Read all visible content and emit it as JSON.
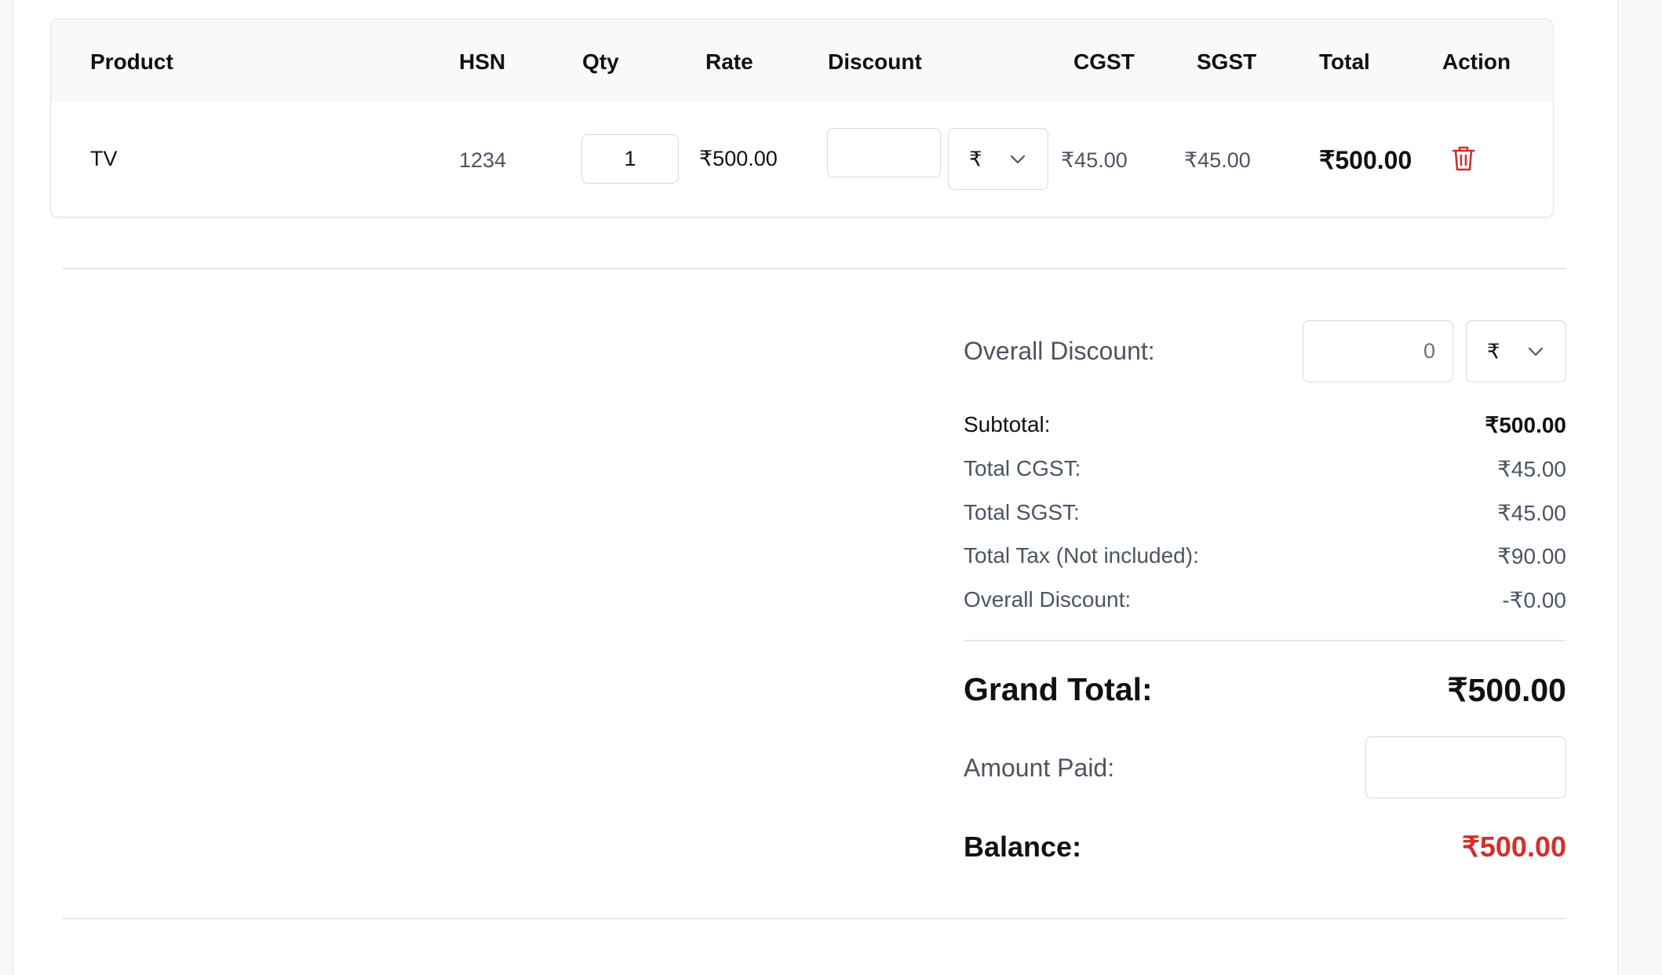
{
  "table": {
    "headers": {
      "product": "Product",
      "hsn": "HSN",
      "qty": "Qty",
      "rate": "Rate",
      "discount": "Discount",
      "cgst": "CGST",
      "sgst": "SGST",
      "total": "Total",
      "action": "Action"
    },
    "rows": [
      {
        "product": "TV",
        "hsn": "1234",
        "qty": "1",
        "rate": "₹500.00",
        "discount_value": "",
        "discount_type": "₹",
        "cgst": "₹45.00",
        "sgst": "₹45.00",
        "total": "₹500.00"
      }
    ]
  },
  "summary": {
    "overall_discount_label": "Overall Discount:",
    "overall_discount_value": "0",
    "overall_discount_type": "₹",
    "subtotal_label": "Subtotal:",
    "subtotal_value": "₹500.00",
    "total_cgst_label": "Total CGST:",
    "total_cgst_value": "₹45.00",
    "total_sgst_label": "Total SGST:",
    "total_sgst_value": "₹45.00",
    "total_tax_label": "Total Tax (Not included):",
    "total_tax_value": "₹90.00",
    "overall_discount_row_label": "Overall Discount:",
    "overall_discount_row_value": "-₹0.00",
    "grand_total_label": "Grand Total:",
    "grand_total_value": "₹500.00",
    "amount_paid_label": "Amount Paid:",
    "amount_paid_value": "",
    "balance_label": "Balance:",
    "balance_value": "₹500.00"
  },
  "icons": {
    "delete": "trash-icon",
    "dropdown": "chevron-down-icon"
  },
  "colors": {
    "danger": "#d0302b",
    "muted_text": "#4b5563",
    "border": "#d6d9de"
  }
}
